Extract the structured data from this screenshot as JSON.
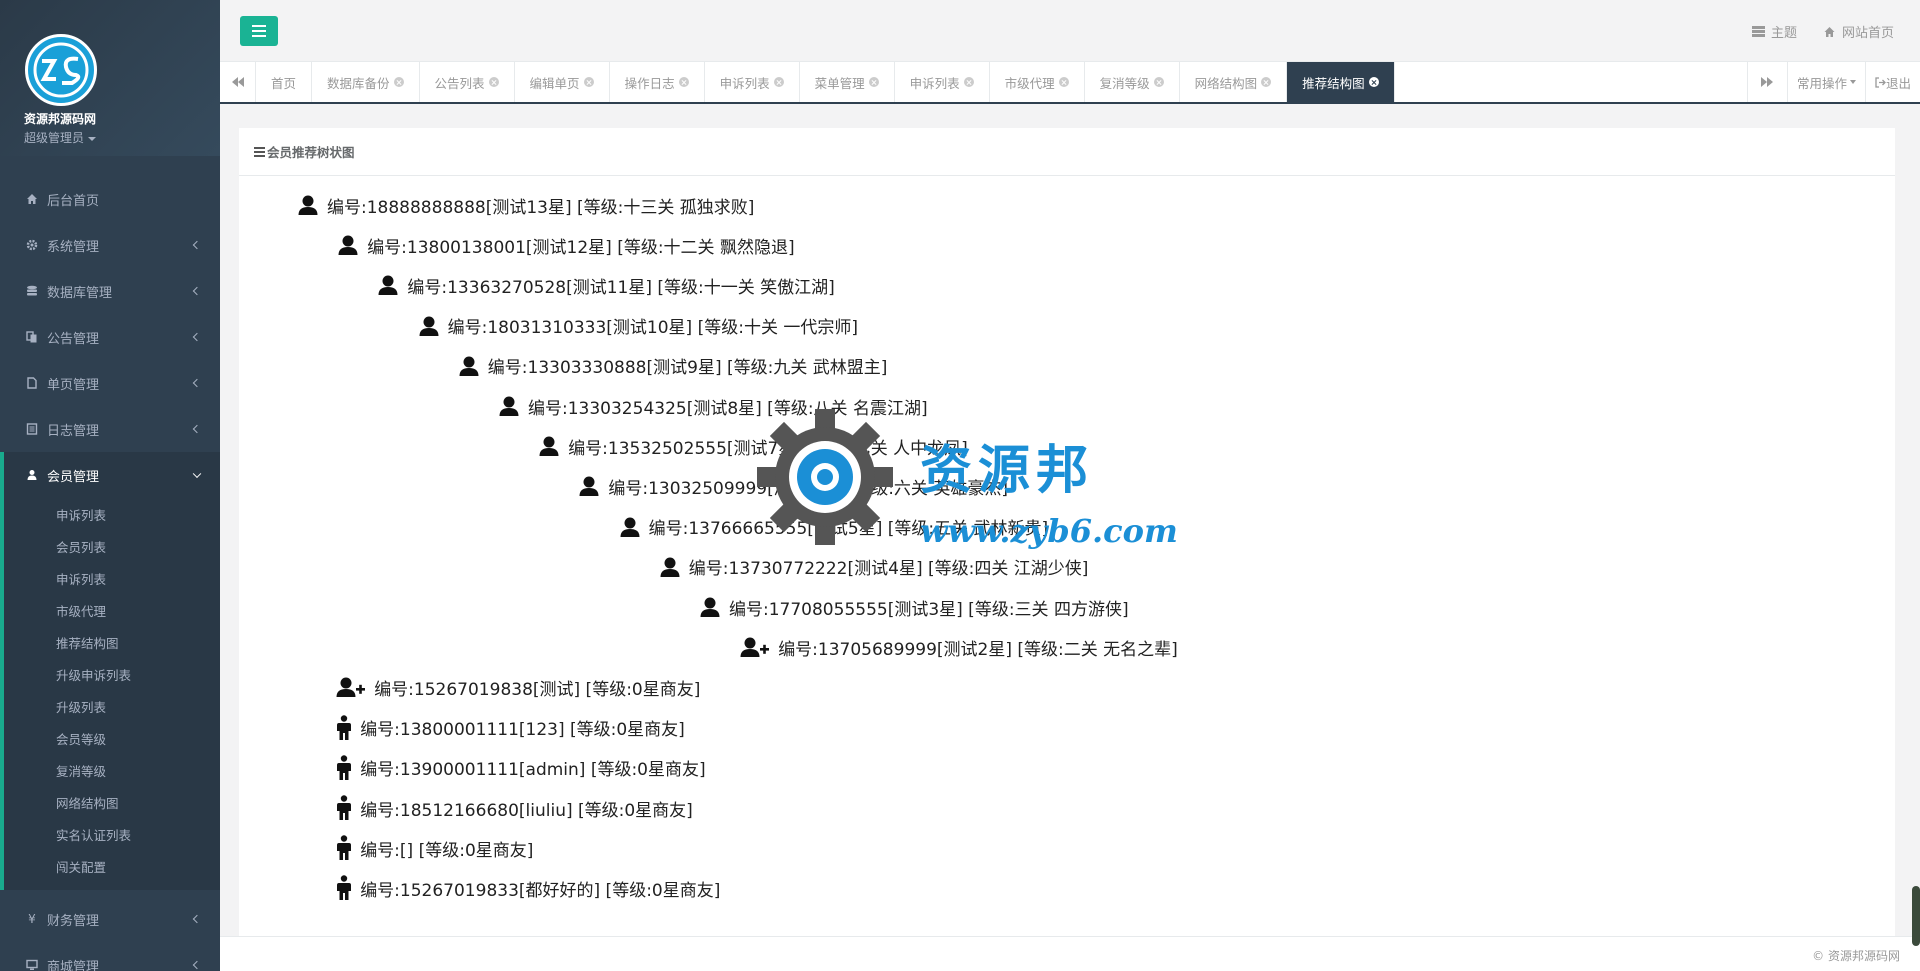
{
  "sidebar": {
    "brand": "资源邦源码网",
    "role": "超级管理员",
    "items": [
      {
        "label": "后台首页",
        "icon": "home-icon"
      },
      {
        "label": "系统管理",
        "icon": "gear-icon"
      },
      {
        "label": "数据库管理",
        "icon": "database-icon"
      },
      {
        "label": "公告管理",
        "icon": "copy-icon"
      },
      {
        "label": "单页管理",
        "icon": "file-icon"
      },
      {
        "label": "日志管理",
        "icon": "list-icon"
      },
      {
        "label": "会员管理",
        "icon": "user-icon"
      }
    ],
    "member_sub": [
      "申诉列表",
      "会员列表",
      "申诉列表",
      "市级代理",
      "推荐结构图",
      "升级申诉列表",
      "升级列表",
      "会员等级",
      "复消等级",
      "网络结构图",
      "实名认证列表",
      "闯关配置"
    ],
    "after": [
      {
        "label": "财务管理",
        "icon": "yen-icon"
      },
      {
        "label": "商城管理",
        "icon": "monitor-icon"
      }
    ]
  },
  "topbar": {
    "theme_label": "主题",
    "home_label": "网站首页"
  },
  "tabs": [
    "首页",
    "数据库备份",
    "公告列表",
    "编辑单页",
    "操作日志",
    "申诉列表",
    "菜单管理",
    "申诉列表",
    "市级代理",
    "复消等级",
    "网络结构图",
    "推荐结构图"
  ],
  "tab_right": {
    "ops_label": "常用操作",
    "logout_label": "退出"
  },
  "panel": {
    "title": "会员推荐树状图"
  },
  "tree": [
    {
      "text": "编号:18888888888[测试13星] [等级:十三关 孤独求败]",
      "icon": "user"
    },
    {
      "text": "编号:13800138001[测试12星] [等级:十二关 飘然隐退]",
      "icon": "user"
    },
    {
      "text": "编号:13363270528[测试11星] [等级:十一关 笑傲江湖]",
      "icon": "user"
    },
    {
      "text": "编号:18031310333[测试10星] [等级:十关 一代宗师]",
      "icon": "user"
    },
    {
      "text": "编号:13303330888[测试9星] [等级:九关 武林盟主]",
      "icon": "user"
    },
    {
      "text": "编号:13303254325[测试8星] [等级:八关 名震江湖]",
      "icon": "user"
    },
    {
      "text": "编号:13532502555[测试7星] [等级:七关 人中龙凤]",
      "icon": "user"
    },
    {
      "text": "编号:13032509999[测试6星] [等级:六关 英雄豪杰]",
      "icon": "user"
    },
    {
      "text": "编号:13766665555[测试5星] [等级:五关 武林新贵]",
      "icon": "user"
    },
    {
      "text": "编号:13730772222[测试4星] [等级:四关 江湖少侠]",
      "icon": "user"
    },
    {
      "text": "编号:17708055555[测试3星] [等级:三关 四方游侠]",
      "icon": "user"
    },
    {
      "text": "编号:13705689999[测试2星] [等级:二关 无名之辈]",
      "icon": "user-plus"
    },
    {
      "text": "编号:15267019838[测试] [等级:0星商友]",
      "icon": "user-plus"
    },
    {
      "text": "编号:13800001111[123] [等级:0星商友]",
      "icon": "male"
    },
    {
      "text": "编号:13900001111[admin] [等级:0星商友]",
      "icon": "male"
    },
    {
      "text": "编号:18512166680[liuliu] [等级:0星商友]",
      "icon": "male"
    },
    {
      "text": "编号:[] [等级:0星商友]",
      "icon": "male"
    },
    {
      "text": "编号:15267019833[都好好的] [等级:0星商友]",
      "icon": "male"
    }
  ],
  "watermark": {
    "text": "资源邦",
    "url": "www.zyb6.com"
  },
  "footer": "© 资源邦源码网",
  "colors": {
    "sidebar_bg": "#2f4050",
    "accent": "#1ab394",
    "active_tab": "#2f4050"
  }
}
